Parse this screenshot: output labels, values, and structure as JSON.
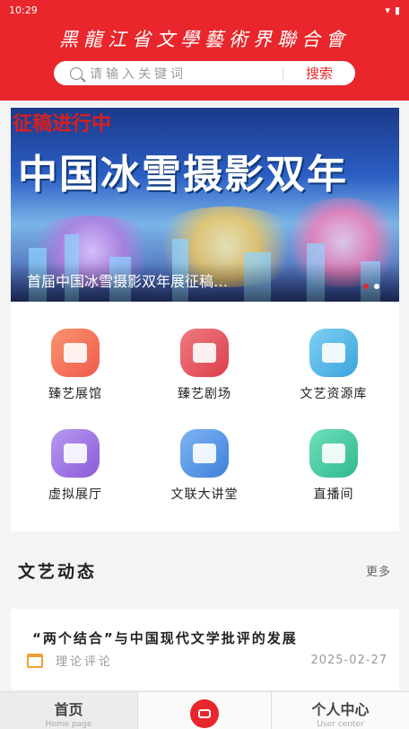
{
  "status": {
    "time": "10:29"
  },
  "header": {
    "title": "黑龍江省文學藝術界聯合會",
    "search": {
      "placeholder": "请输入关键词",
      "button": "搜索"
    }
  },
  "banner": {
    "tag": "征稿进行中",
    "headline": "中国冰雪摄影双年",
    "caption": "首届中国冰雪摄影双年展征稿…",
    "slides": 2,
    "active_slide": 2
  },
  "grid": [
    {
      "label": "臻艺展馆",
      "icon": "gallery-icon",
      "color": "#f4775b"
    },
    {
      "label": "臻艺剧场",
      "icon": "theater-icon",
      "color": "#e5535f"
    },
    {
      "label": "文艺资源库",
      "icon": "library-icon",
      "color": "#4fb6e6"
    },
    {
      "label": "虚拟展厅",
      "icon": "vr-icon",
      "color": "#9b6fe0"
    },
    {
      "label": "文联大讲堂",
      "icon": "lecture-icon",
      "color": "#4f93e6"
    },
    {
      "label": "直播间",
      "icon": "live-icon",
      "color": "#3ec99e"
    }
  ],
  "news_section": {
    "title": "文艺动态",
    "more": "更多"
  },
  "news": [
    {
      "title": "“两个结合”与中国现代文学批评的发展",
      "category": "理论评论",
      "date": "2025-02-27"
    }
  ],
  "tabbar": {
    "home": {
      "label": "首页",
      "sub": "Home page"
    },
    "user": {
      "label": "个人中心",
      "sub": "User center"
    },
    "accent": "#e8262b"
  }
}
